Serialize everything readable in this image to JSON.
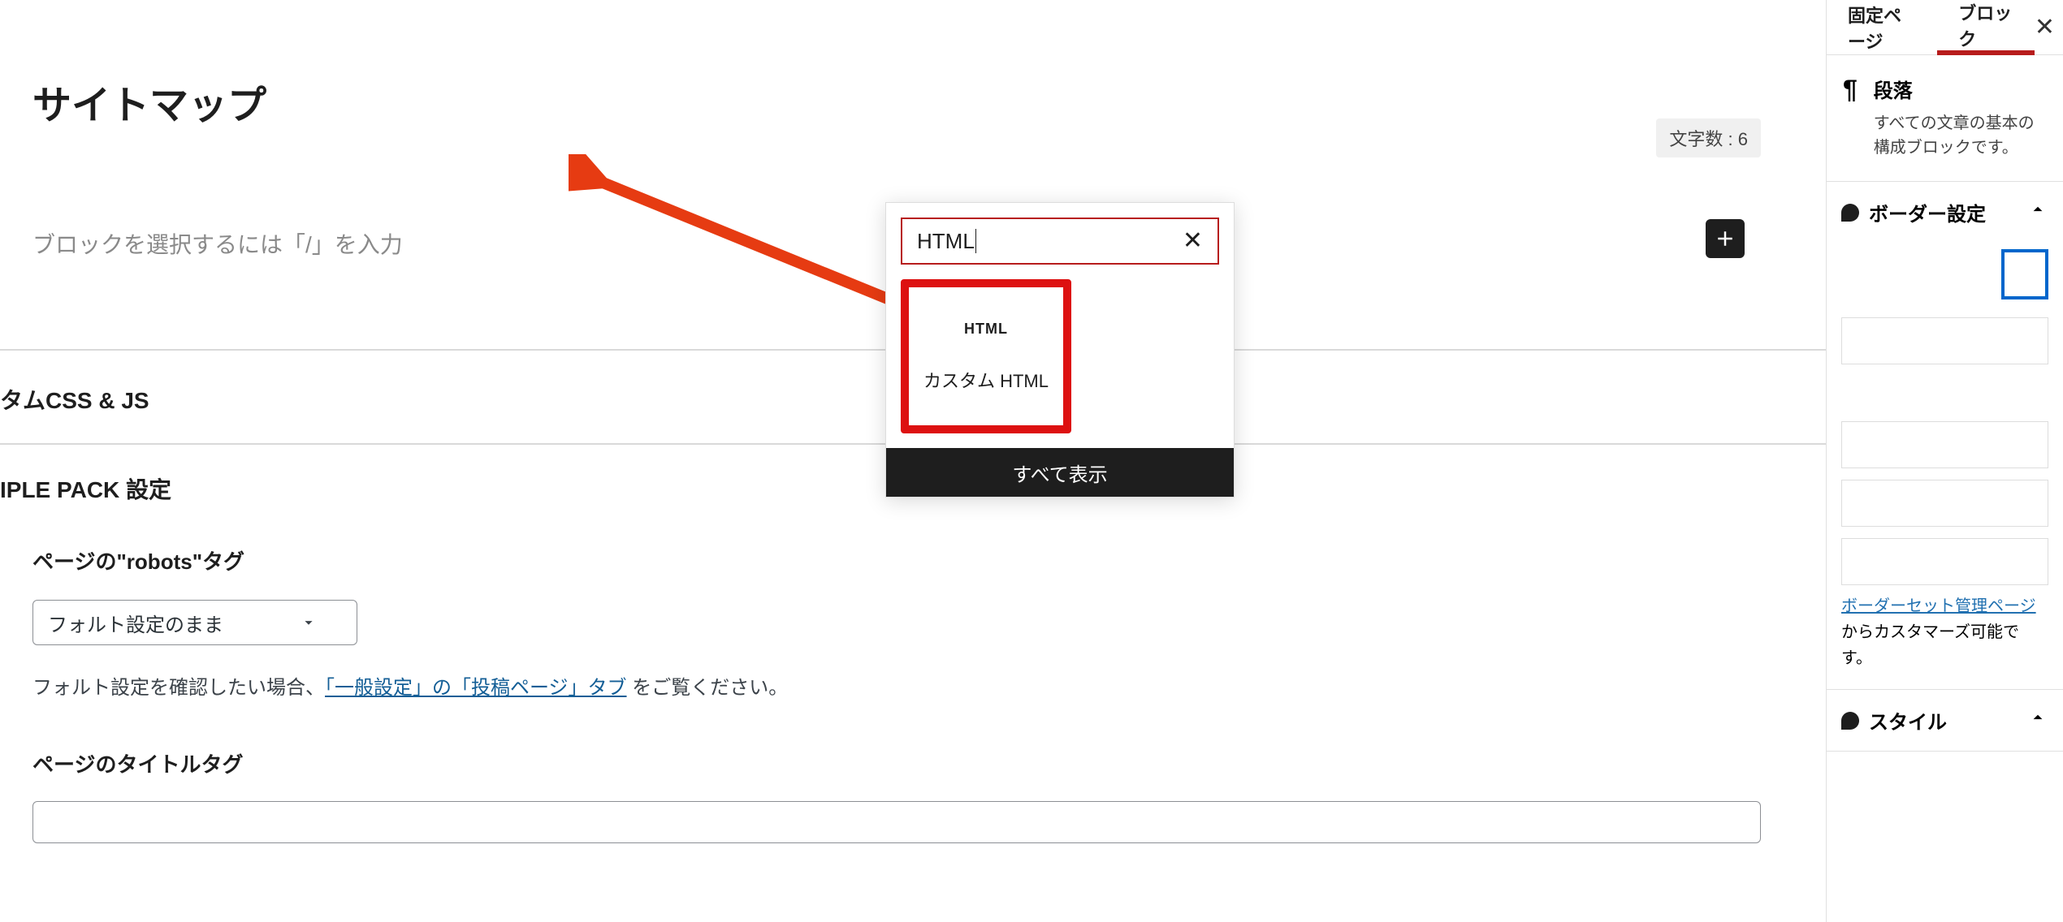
{
  "editor": {
    "page_title": "サイトマップ",
    "char_count_label": "文字数 : 6",
    "placeholder": "ブロックを選択するには「/」を入力",
    "sections": {
      "custom_css_js": "タムCSS & JS",
      "simple_pack": "IPLE PACK 設定",
      "robots_tag": "ページの\"robots\"タグ",
      "robots_select": "フォルト設定のまま",
      "robots_help_prefix": "フォルト設定を確認したい場合、",
      "robots_help_link": "「一般設定」の「投稿ページ」タブ",
      "robots_help_suffix": " をご覧ください。",
      "title_tag": "ページのタイトルタグ"
    }
  },
  "popup": {
    "search_value": "HTML",
    "result_icon": "HTML",
    "result_label": "カスタム HTML",
    "show_all": "すべて表示"
  },
  "sidebar": {
    "tabs": {
      "page": "固定ページ",
      "block": "ブロック"
    },
    "block_info": {
      "title": "段落",
      "desc": "すべての文章の基本の構成ブロックです。"
    },
    "border_panel": "ボーダー設定",
    "border_help_link": "ボーダーセット管理ページ",
    "border_help_suffix": "からカスタマーズ可能です。",
    "style_panel": "スタイル"
  }
}
